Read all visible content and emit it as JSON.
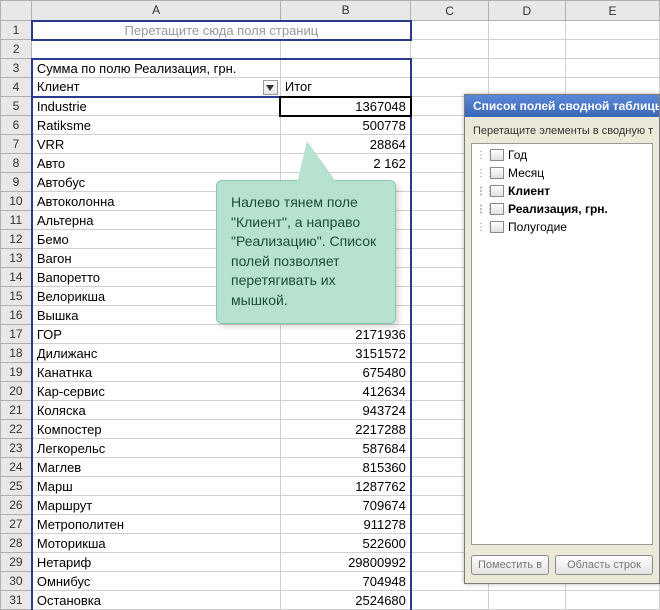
{
  "columns": [
    "A",
    "B",
    "C",
    "D",
    "E"
  ],
  "drop_hint": "Перетащите сюда поля страниц",
  "pivot_measure": "Сумма по полю Реализация, грн.",
  "client_header": "Клиент",
  "total_header": "Итог",
  "selected_value": "1367048",
  "rows": [
    {
      "n": 5,
      "client": "Industrie",
      "val": "1367048"
    },
    {
      "n": 6,
      "client": "Ratiksme",
      "val": "500778"
    },
    {
      "n": 7,
      "client": "VRR",
      "val": "28864"
    },
    {
      "n": 8,
      "client": "Авто",
      "val": "2    162"
    },
    {
      "n": 9,
      "client": "Автобус",
      "val": ""
    },
    {
      "n": 10,
      "client": "Автоколонна",
      "val": ""
    },
    {
      "n": 11,
      "client": "Альтерна",
      "val": ""
    },
    {
      "n": 12,
      "client": "Бемо",
      "val": ""
    },
    {
      "n": 13,
      "client": "Вагон",
      "val": ""
    },
    {
      "n": 14,
      "client": "Вапоретто",
      "val": ""
    },
    {
      "n": 15,
      "client": "Велорикша",
      "val": ""
    },
    {
      "n": 16,
      "client": "Вышка",
      "val": ""
    },
    {
      "n": 17,
      "client": "ГОР",
      "val": "2171936"
    },
    {
      "n": 18,
      "client": "Дилижанс",
      "val": "3151572"
    },
    {
      "n": 19,
      "client": "Канатнка",
      "val": "675480"
    },
    {
      "n": 20,
      "client": "Кар-сервис",
      "val": "412634"
    },
    {
      "n": 21,
      "client": "Коляска",
      "val": "943724"
    },
    {
      "n": 22,
      "client": "Компостер",
      "val": "2217288"
    },
    {
      "n": 23,
      "client": "Легкорельс",
      "val": "587684"
    },
    {
      "n": 24,
      "client": "Маглев",
      "val": "815360"
    },
    {
      "n": 25,
      "client": "Марш",
      "val": "1287762"
    },
    {
      "n": 26,
      "client": "Маршрут",
      "val": "709674"
    },
    {
      "n": 27,
      "client": "Метрополитен",
      "val": "911278"
    },
    {
      "n": 28,
      "client": "Моторикша",
      "val": "522600"
    },
    {
      "n": 29,
      "client": "Нетариф",
      "val": "29800992"
    },
    {
      "n": 30,
      "client": "Омнибус",
      "val": "704948"
    },
    {
      "n": 31,
      "client": "Остановка",
      "val": "2524680"
    }
  ],
  "callout_text": "Налево тянем поле \"Клиент\", а направо \"Реализацию\". Список полей позволяет перетягивать их мышкой.",
  "field_panel": {
    "title": "Список полей сводной таблицы",
    "subtitle": "Перетащите элементы в сводную т",
    "items": [
      {
        "label": "Год",
        "bold": false
      },
      {
        "label": "Месяц",
        "bold": false
      },
      {
        "label": "Клиент",
        "bold": true
      },
      {
        "label": "Реализация, грн.",
        "bold": true
      },
      {
        "label": "Полугодие",
        "bold": false
      }
    ],
    "btn_place": "Поместить в",
    "btn_area": "Область строк"
  },
  "chart_data": {
    "type": "table",
    "title": "Сумма по полю Реализация, грн.",
    "columns": [
      "Клиент",
      "Итог"
    ],
    "rows": [
      [
        "Industrie",
        1367048
      ],
      [
        "Ratiksme",
        500778
      ],
      [
        "VRR",
        28864
      ],
      [
        "Авто",
        2162
      ],
      [
        "Автобус",
        null
      ],
      [
        "Автоколонна",
        null
      ],
      [
        "Альтерна",
        null
      ],
      [
        "Бемо",
        null
      ],
      [
        "Вагон",
        null
      ],
      [
        "Вапоретто",
        null
      ],
      [
        "Велорикша",
        null
      ],
      [
        "Вышка",
        null
      ],
      [
        "ГОР",
        2171936
      ],
      [
        "Дилижанс",
        3151572
      ],
      [
        "Канатнка",
        675480
      ],
      [
        "Кар-сервис",
        412634
      ],
      [
        "Коляска",
        943724
      ],
      [
        "Компостер",
        2217288
      ],
      [
        "Легкорельс",
        587684
      ],
      [
        "Маглев",
        815360
      ],
      [
        "Марш",
        1287762
      ],
      [
        "Маршрут",
        709674
      ],
      [
        "Метрополитен",
        911278
      ],
      [
        "Моторикша",
        522600
      ],
      [
        "Нетариф",
        29800992
      ],
      [
        "Омнибус",
        704948
      ],
      [
        "Остановка",
        2524680
      ]
    ]
  }
}
